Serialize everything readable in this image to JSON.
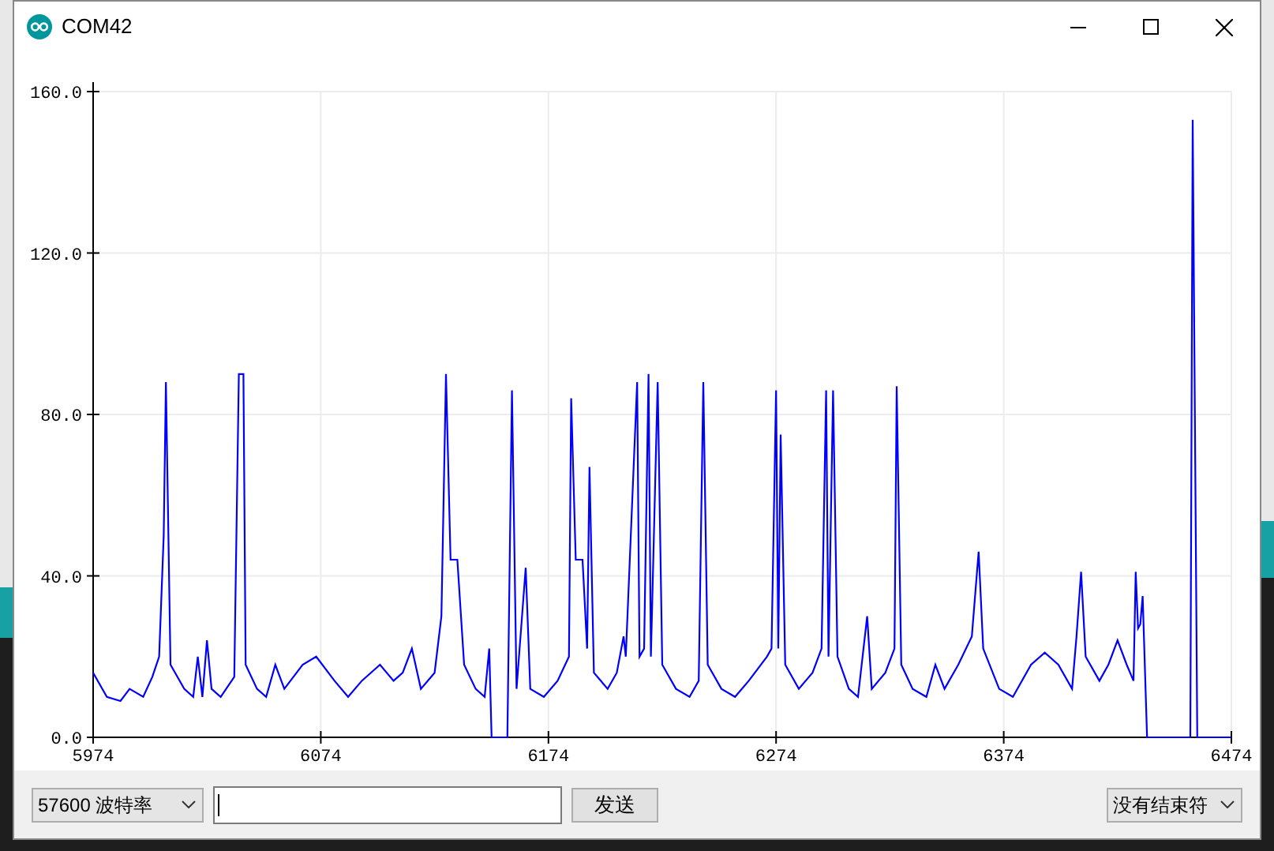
{
  "window": {
    "title": "COM42"
  },
  "plot": {
    "chart_data": {
      "type": "line",
      "grid": true,
      "xlim": [
        5974,
        6474
      ],
      "ylim": [
        0,
        160
      ],
      "xticks": [
        5974,
        6074,
        6174,
        6274,
        6374,
        6474
      ],
      "yticks": [
        {
          "value": 0,
          "label": "0.0"
        },
        {
          "value": 40,
          "label": "40.0"
        },
        {
          "value": 80,
          "label": "80.0"
        },
        {
          "value": 120,
          "label": "120.0"
        },
        {
          "value": 160,
          "label": "160.0"
        }
      ],
      "x": [
        5974,
        5980,
        5986,
        5990,
        5996,
        6000,
        6003,
        6005,
        6006,
        6008,
        6014,
        6018,
        6020,
        6022,
        6024,
        6026,
        6030,
        6036,
        6038,
        6040,
        6041,
        6046,
        6050,
        6054,
        6058,
        6066,
        6072,
        6080,
        6086,
        6092,
        6100,
        6106,
        6110,
        6114,
        6118,
        6124,
        6127,
        6129,
        6131,
        6134,
        6137,
        6142,
        6146,
        6148,
        6149,
        6156,
        6158,
        6160,
        6164,
        6166,
        6172,
        6178,
        6183,
        6184,
        6186,
        6189,
        6191,
        6192,
        6194,
        6200,
        6204,
        6207,
        6208,
        6213,
        6214,
        6216,
        6218,
        6219,
        6222,
        6224,
        6230,
        6236,
        6240,
        6242,
        6244,
        6250,
        6256,
        6262,
        6270,
        6272,
        6274,
        6275,
        6276,
        6278,
        6284,
        6290,
        6294,
        6296,
        6297,
        6299,
        6301,
        6306,
        6310,
        6314,
        6316,
        6322,
        6326,
        6327,
        6329,
        6334,
        6340,
        6344,
        6348,
        6354,
        6360,
        6363,
        6365,
        6372,
        6378,
        6386,
        6392,
        6398,
        6404,
        6406,
        6408,
        6410,
        6416,
        6420,
        6424,
        6428,
        6431,
        6432,
        6433,
        6434,
        6435,
        6437,
        6456,
        6457,
        6459,
        6474
      ],
      "series": [
        {
          "color": "#0000ff",
          "values": [
            16,
            10,
            9,
            12,
            10,
            15,
            20,
            50,
            88,
            18,
            12,
            10,
            20,
            10,
            24,
            12,
            10,
            15,
            90,
            90,
            18,
            12,
            10,
            18,
            12,
            18,
            20,
            14,
            10,
            14,
            18,
            14,
            16,
            22,
            12,
            16,
            30,
            90,
            44,
            44,
            18,
            12,
            10,
            22,
            0,
            0,
            86,
            12,
            42,
            12,
            10,
            14,
            20,
            84,
            44,
            44,
            22,
            67,
            16,
            12,
            16,
            25,
            20,
            88,
            20,
            22,
            90,
            20,
            88,
            18,
            12,
            10,
            14,
            88,
            18,
            12,
            10,
            14,
            20,
            22,
            86,
            22,
            75,
            18,
            12,
            16,
            22,
            86,
            20,
            86,
            20,
            12,
            10,
            30,
            12,
            16,
            22,
            87,
            18,
            12,
            10,
            18,
            12,
            18,
            25,
            46,
            22,
            12,
            10,
            18,
            21,
            18,
            12,
            25,
            41,
            20,
            14,
            18,
            24,
            18,
            14,
            41,
            27,
            28,
            35,
            0,
            0,
            153,
            0,
            0
          ]
        }
      ]
    }
  },
  "controls": {
    "baud_rate": "57600 波特率",
    "send_button": "发送",
    "line_ending": "没有结束符"
  }
}
